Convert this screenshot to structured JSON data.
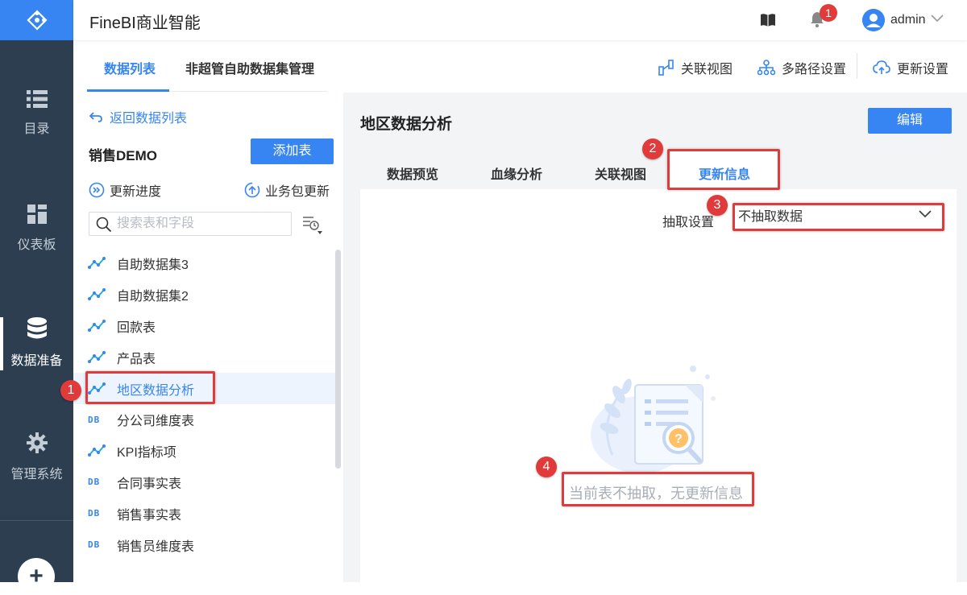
{
  "app": {
    "title": "FineBI商业智能"
  },
  "header": {
    "notification_count": "1",
    "user_name": "admin"
  },
  "rail": {
    "items": [
      {
        "label": "目录",
        "icon": "list-icon"
      },
      {
        "label": "仪表板",
        "icon": "dashboard-icon"
      },
      {
        "label": "数据准备",
        "icon": "database-icon"
      },
      {
        "label": "管理系统",
        "icon": "gear-icon"
      }
    ],
    "add_label": "+"
  },
  "subtabs": [
    {
      "label": "数据列表"
    },
    {
      "label": "非超管自助数据集管理"
    }
  ],
  "toolbar": {
    "relation_view": "关联视图",
    "multipath": "多路径设置",
    "update_settings": "更新设置"
  },
  "left": {
    "back_label": "返回数据列表",
    "package_name": "销售DEMO",
    "add_table_label": "添加表",
    "update_progress_label": "更新进度",
    "package_update_label": "业务包更新",
    "search_placeholder": "搜索表和字段",
    "tables": [
      {
        "name": "自助数据集3",
        "type": "self"
      },
      {
        "name": "自助数据集2",
        "type": "self"
      },
      {
        "name": "回款表",
        "type": "self"
      },
      {
        "name": "产品表",
        "type": "self"
      },
      {
        "name": "地区数据分析",
        "type": "self",
        "selected": true
      },
      {
        "name": "分公司维度表",
        "type": "db"
      },
      {
        "name": "KPI指标项",
        "type": "self"
      },
      {
        "name": "合同事实表",
        "type": "db"
      },
      {
        "name": "销售事实表",
        "type": "db"
      },
      {
        "name": "销售员维度表",
        "type": "db"
      }
    ],
    "db_icon_text": "DB"
  },
  "detail": {
    "title": "地区数据分析",
    "edit_label": "编辑",
    "tabs": [
      {
        "label": "数据预览"
      },
      {
        "label": "血缘分析"
      },
      {
        "label": "关联视图"
      },
      {
        "label": "更新信息"
      }
    ],
    "extract_label": "抽取设置",
    "extract_value": "不抽取数据",
    "empty_text": "当前表不抽取，无更新信息"
  },
  "annotations": [
    "1",
    "2",
    "3",
    "4"
  ],
  "colors": {
    "accent": "#3685f2",
    "rail": "#2c3e50",
    "annotation": "#e03a3a"
  }
}
